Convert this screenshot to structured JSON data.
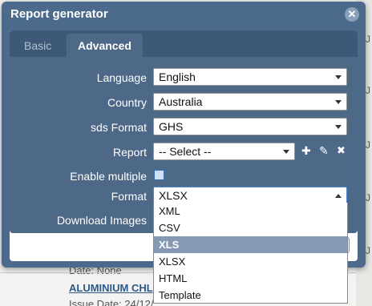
{
  "dialog": {
    "title": "Report generator",
    "close_glyph": "✕",
    "tabs": [
      {
        "label": "Basic"
      },
      {
        "label": "Advanced"
      }
    ],
    "fields": {
      "language": {
        "label": "Language",
        "value": "English"
      },
      "country": {
        "label": "Country",
        "value": "Australia"
      },
      "sds_format": {
        "label": "sds Format",
        "value": "GHS"
      },
      "report": {
        "label": "Report",
        "value": "-- Select --"
      },
      "enable_multiple": {
        "label": "Enable multiple"
      },
      "format": {
        "label": "Format",
        "value": "XLSX"
      },
      "download_images": {
        "label": "Download Images"
      }
    },
    "report_actions": {
      "add_glyph": "✚",
      "edit_glyph": "✎",
      "delete_glyph": "✖"
    }
  },
  "format_options": [
    "XML",
    "CSV",
    "XLS",
    "XLSX",
    "HTML",
    "Template"
  ],
  "highlighted_option": "XLS",
  "background": {
    "row1": "Date: None",
    "link": "ALUMINIUM CHL",
    "row2": "Issue Date: 24/12/"
  },
  "icons": {
    "close": "close-icon",
    "add": "plus-icon",
    "edit": "edit-icon",
    "delete": "delete-icon",
    "dropdown": "chevron-down-icon"
  },
  "colors": {
    "dialog_bg": "#4c6a8c",
    "tab_active": "#4d6987",
    "highlight": "#8699b4"
  }
}
